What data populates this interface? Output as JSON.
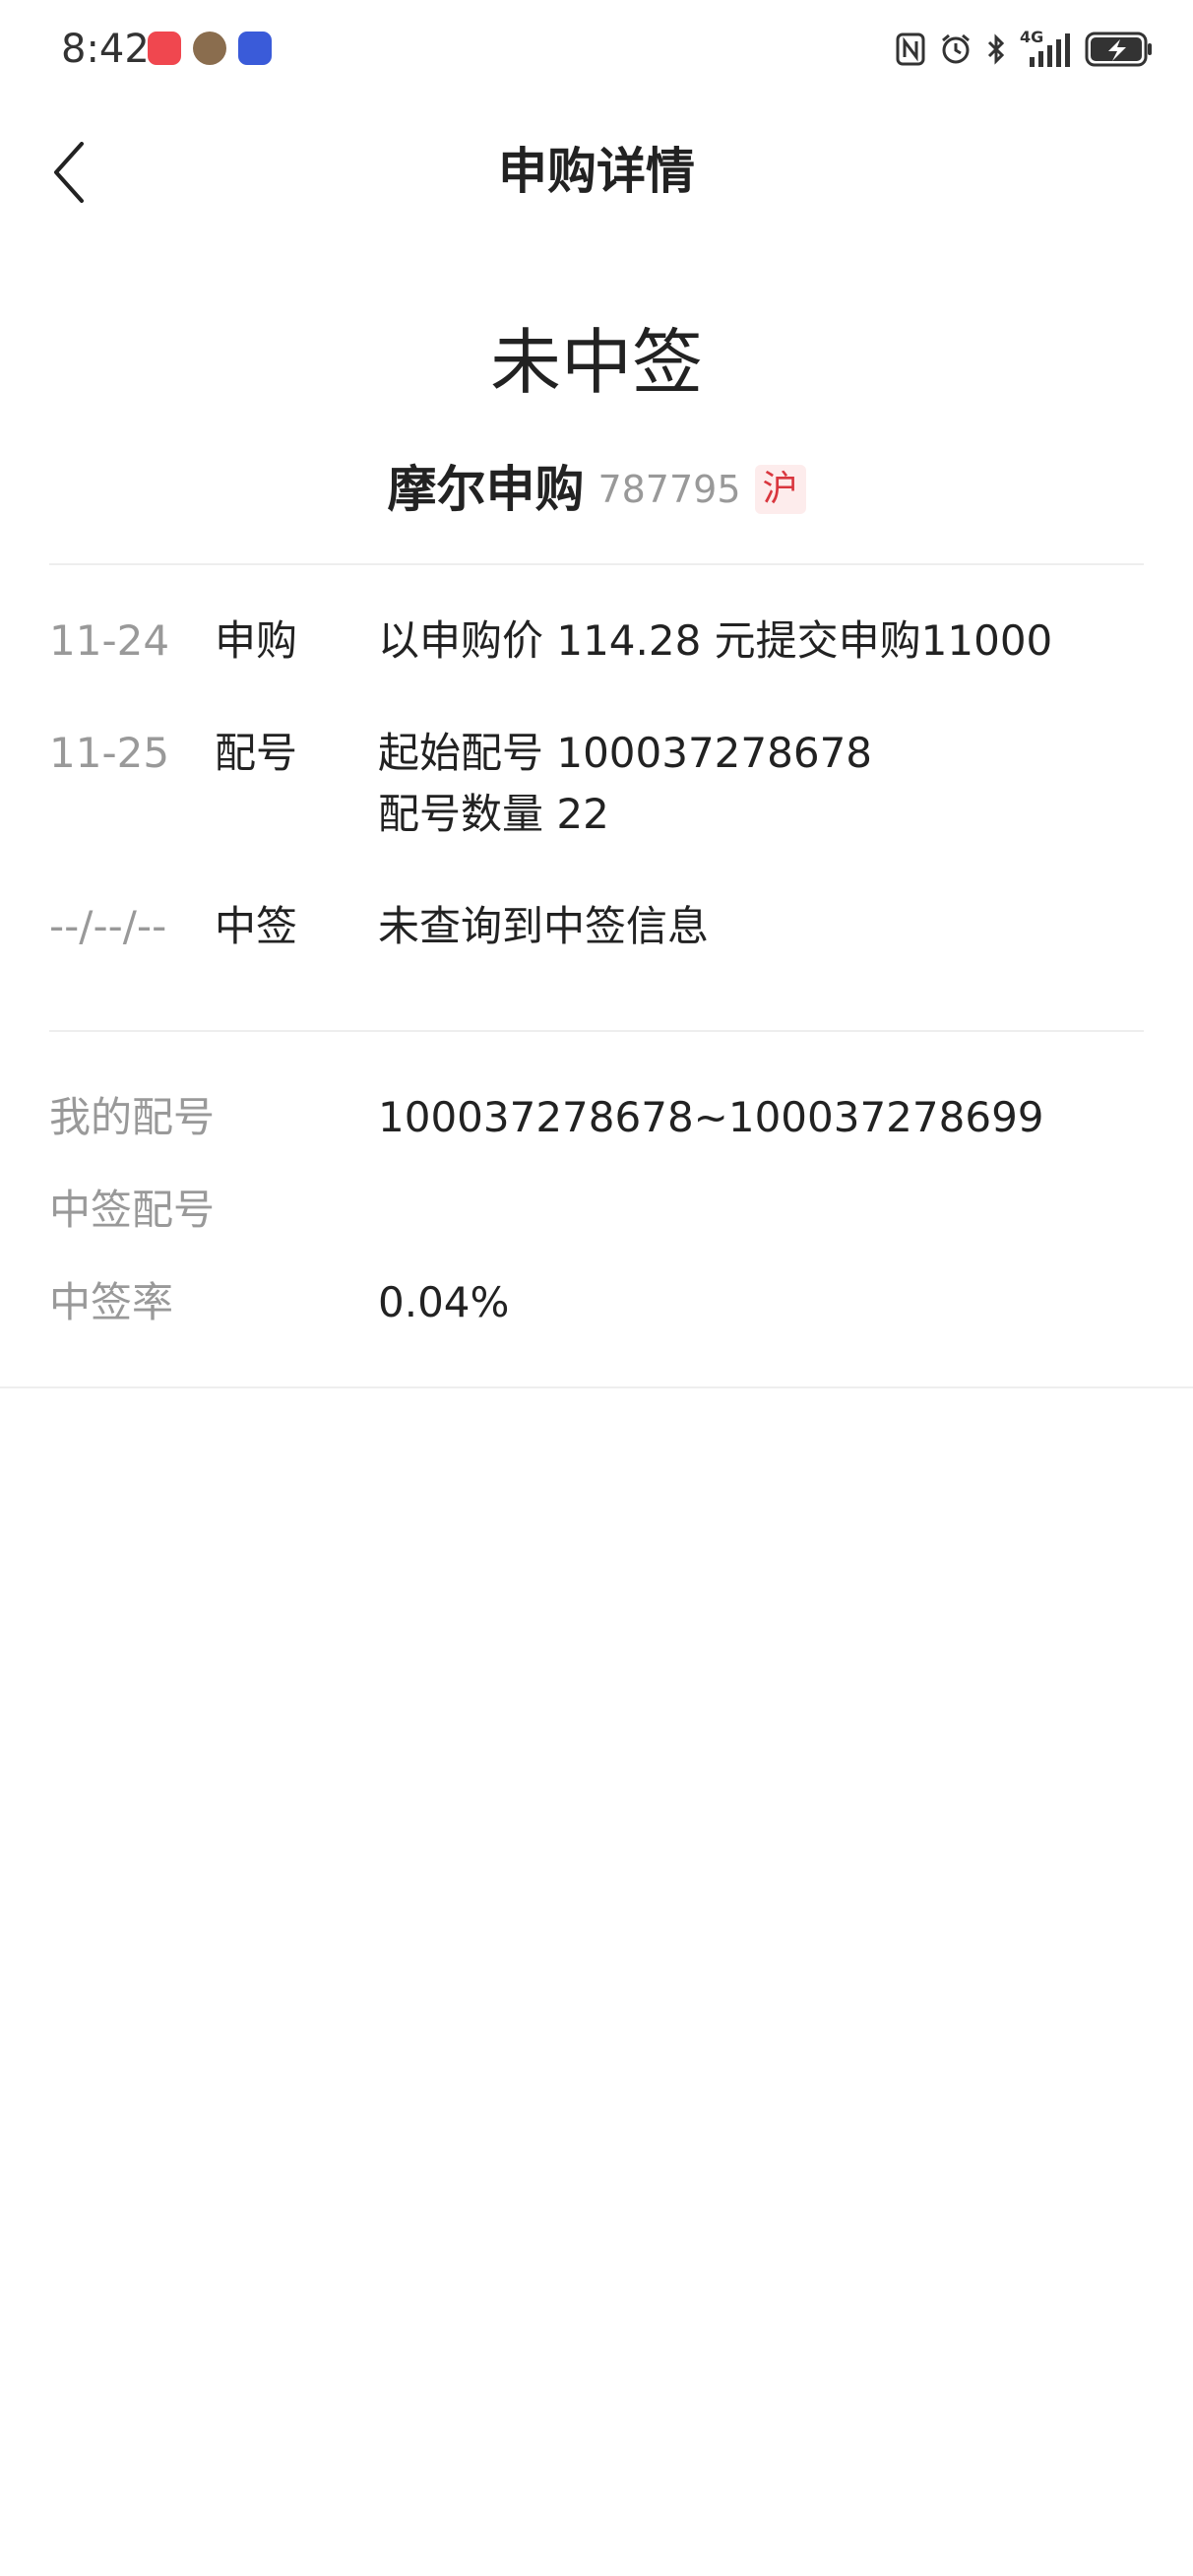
{
  "status_bar": {
    "time": "8:42",
    "network": "4G",
    "icons": [
      "huawei-appgallery-icon",
      "avatar-app-icon",
      "baidu-app-icon",
      "nfc-icon",
      "alarm-icon",
      "bluetooth-icon",
      "signal-icon",
      "battery-charging-icon"
    ]
  },
  "header": {
    "title": "申购详情",
    "back_icon": "chevron-left-icon"
  },
  "result": {
    "status": "未中签",
    "stock_name": "摩尔申购",
    "stock_code": "787795",
    "market": "沪"
  },
  "timeline": [
    {
      "date": "11-24",
      "event": "申购",
      "details": [
        "以申购价 114.28 元提交申购11000"
      ]
    },
    {
      "date": "11-25",
      "event": "配号",
      "details": [
        "起始配号 100037278678",
        "配号数量 22"
      ]
    },
    {
      "date": "--/--/--",
      "event": "中签",
      "details": [
        "未查询到中签信息"
      ]
    }
  ],
  "info": {
    "my_numbers_label": "我的配号",
    "my_numbers_value": "100037278678~100037278699",
    "winning_numbers_label": "中签配号",
    "winning_numbers_value": "",
    "win_rate_label": "中签率",
    "win_rate_value": "0.04%"
  },
  "colors": {
    "primary_text": "#222222",
    "secondary_text": "#999999",
    "badge_bg": "#fdecec",
    "badge_text": "#d9363e",
    "divider": "#eeeeee"
  }
}
